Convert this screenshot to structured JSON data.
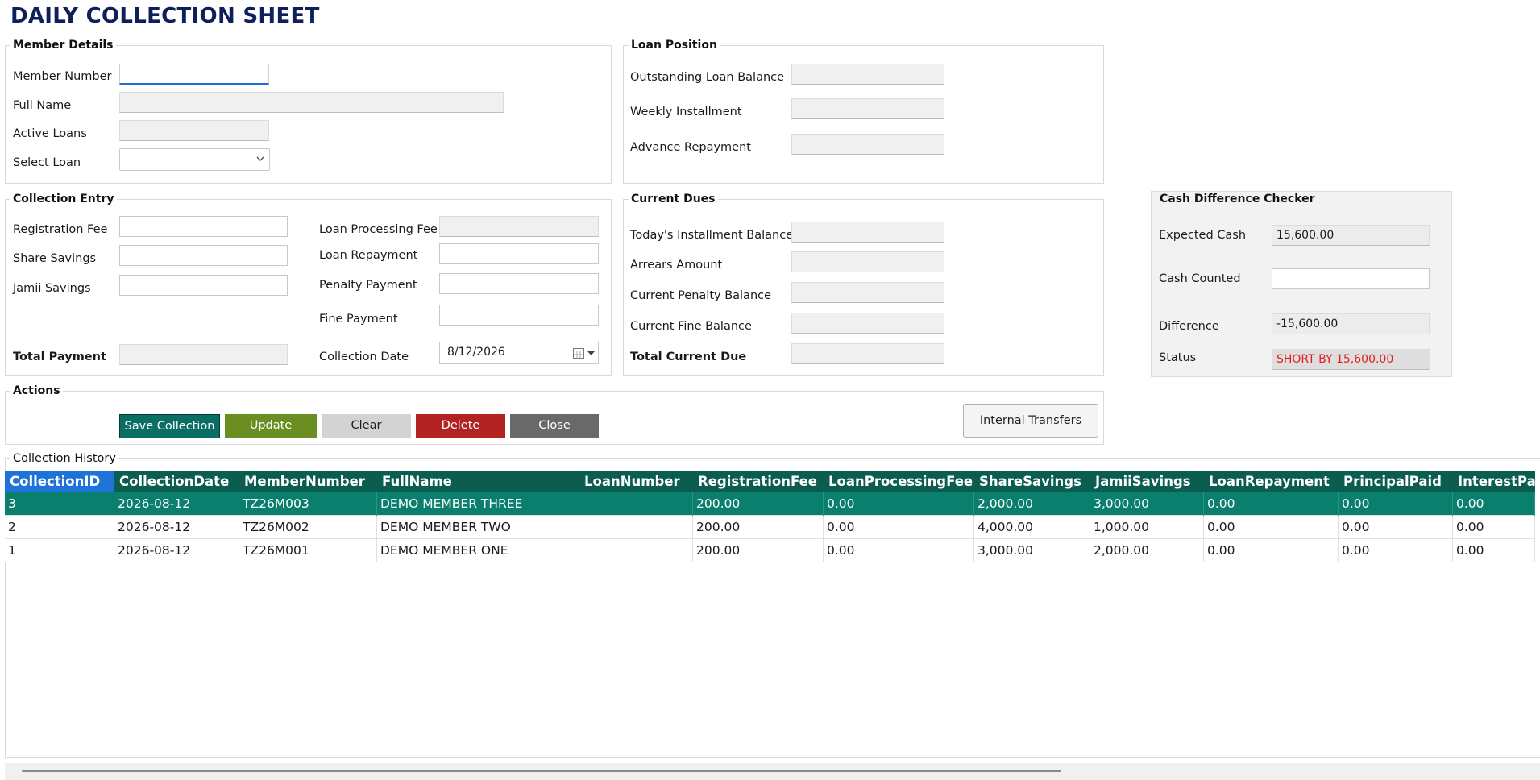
{
  "page": {
    "title": "DAILY COLLECTION SHEET"
  },
  "member_details": {
    "heading": "Member Details",
    "member_number_label": "Member Number",
    "member_number_value": "",
    "full_name_label": "Full Name",
    "full_name_value": "",
    "active_loans_label": "Active Loans",
    "active_loans_value": "",
    "select_loan_label": "Select Loan",
    "select_loan_value": ""
  },
  "loan_position": {
    "heading": "Loan Position",
    "outstanding_label": "Outstanding Loan Balance",
    "outstanding_value": "",
    "weekly_label": "Weekly Installment",
    "weekly_value": "",
    "advance_label": "Advance Repayment",
    "advance_value": ""
  },
  "collection_entry": {
    "heading": "Collection Entry",
    "registration_fee_label": "Registration Fee",
    "share_savings_label": "Share Savings",
    "jamii_savings_label": "Jamii Savings",
    "total_payment_label": "Total Payment",
    "loan_processing_fee_label": "Loan Processing Fee",
    "loan_repayment_label": "Loan Repayment",
    "penalty_payment_label": "Penalty Payment",
    "fine_payment_label": "Fine Payment",
    "collection_date_label": "Collection Date",
    "collection_date_value": "8/12/2026"
  },
  "current_dues": {
    "heading": "Current Dues",
    "today_label": "Today's Installment Balance",
    "arrears_label": "Arrears Amount",
    "penalty_label": "Current Penalty Balance",
    "fine_label": "Current Fine Balance",
    "total_label": "Total Current Due"
  },
  "cash_checker": {
    "heading": "Cash Difference Checker",
    "expected_label": "Expected Cash",
    "expected_value": "15,600.00",
    "counted_label": "Cash Counted",
    "counted_value": "",
    "difference_label": "Difference",
    "difference_value": "-15,600.00",
    "status_label": "Status",
    "status_value": "SHORT BY 15,600.00",
    "status_color": "#e02020"
  },
  "actions": {
    "heading": "Actions",
    "save_label": "Save Collection",
    "update_label": "Update",
    "clear_label": "Clear",
    "delete_label": "Delete",
    "close_label": "Close",
    "internal_transfers_label": "Internal Transfers"
  },
  "history": {
    "heading": "Collection History",
    "columns": [
      "CollectionID",
      "CollectionDate",
      "MemberNumber",
      "FullName",
      "LoanNumber",
      "RegistrationFee",
      "LoanProcessingFee",
      "ShareSavings",
      "JamiiSavings",
      "LoanRepayment",
      "PrincipalPaid",
      "InterestPaid"
    ],
    "rows": [
      [
        "3",
        "2026-08-12",
        "TZ26M003",
        "DEMO MEMBER THREE",
        "",
        "200.00",
        "0.00",
        "2,000.00",
        "3,000.00",
        "0.00",
        "0.00",
        "0.00"
      ],
      [
        "2",
        "2026-08-12",
        "TZ26M002",
        "DEMO MEMBER TWO",
        "",
        "200.00",
        "0.00",
        "4,000.00",
        "1,000.00",
        "0.00",
        "0.00",
        "0.00"
      ],
      [
        "1",
        "2026-08-12",
        "TZ26M001",
        "DEMO MEMBER ONE",
        "",
        "200.00",
        "0.00",
        "3,000.00",
        "2,000.00",
        "0.00",
        "0.00",
        "0.00"
      ]
    ],
    "selected_row_index": 0
  },
  "colors": {
    "header_bg": "#0b5d4f",
    "selected_row_bg": "#0a7f6e",
    "first_header_bg": "#1e73d8",
    "save_bg": "#0a6e64",
    "update_bg": "#6b8e23",
    "clear_bg": "#d3d3d3",
    "delete_bg": "#b22222",
    "close_bg": "#696969"
  }
}
